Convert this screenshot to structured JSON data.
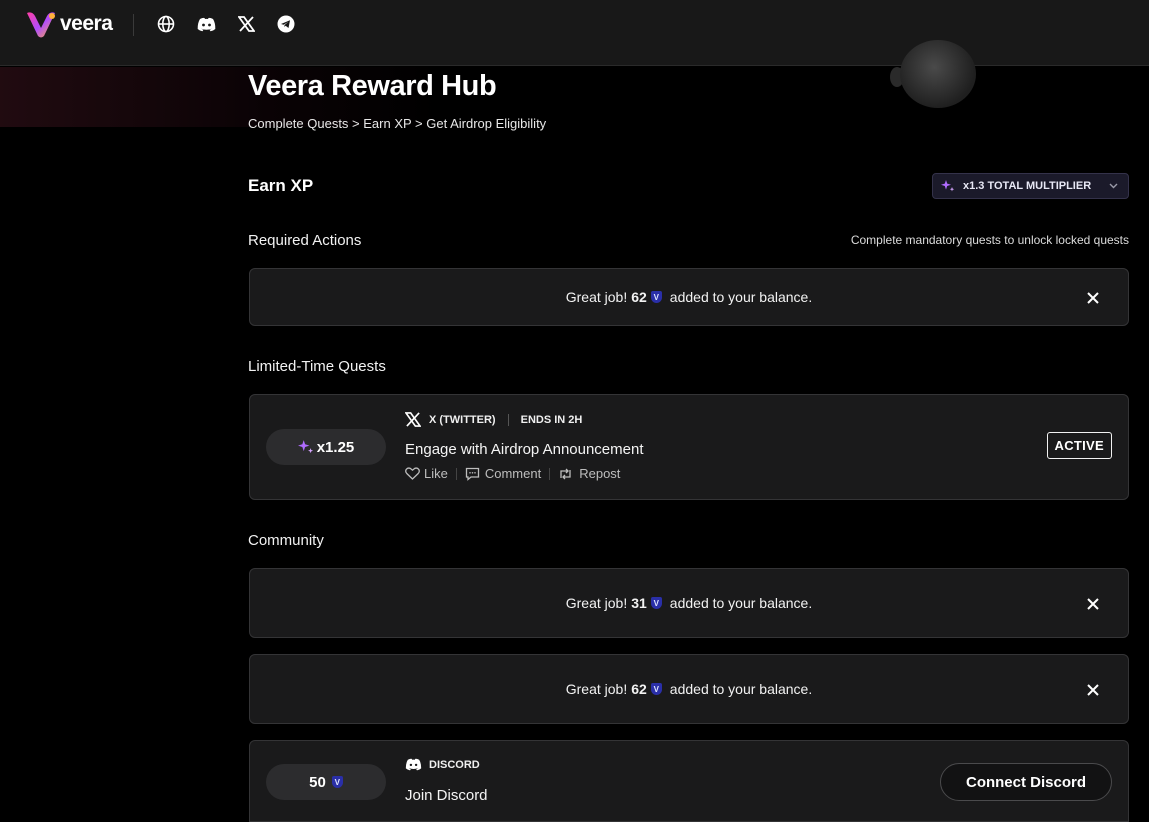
{
  "nav": {
    "logo_text": "veera",
    "socials": [
      "globe-icon",
      "discord-icon",
      "x-icon",
      "telegram-icon"
    ]
  },
  "hero": {
    "title": "Veera Reward Hub",
    "breadcrumb": "Complete Quests > Earn XP > Get Airdrop Eligibility"
  },
  "earn": {
    "heading": "Earn XP",
    "multiplier_label": "x1.3 TOTAL MULTIPLIER"
  },
  "required": {
    "heading": "Required Actions",
    "hint": "Complete mandatory quests to unlock locked quests",
    "toast": {
      "prefix": "Great job!",
      "amount": "62",
      "suffix": "added to your balance."
    }
  },
  "limited": {
    "heading": "Limited-Time Quests",
    "quest": {
      "multiplier": "x1.25",
      "platform": "X (TWITTER)",
      "ends": "ENDS IN 2H",
      "title": "Engage with Airdrop Announcement",
      "actions": [
        "Like",
        "Comment",
        "Repost"
      ],
      "status": "ACTIVE"
    }
  },
  "community": {
    "heading": "Community",
    "toasts": [
      {
        "prefix": "Great job!",
        "amount": "31",
        "suffix": "added to your balance."
      },
      {
        "prefix": "Great job!",
        "amount": "62",
        "suffix": "added to your balance."
      }
    ],
    "discord": {
      "reward": "50",
      "platform": "DISCORD",
      "title": "Join Discord",
      "button": "Connect Discord"
    }
  },
  "token_symbol": "V",
  "colors": {
    "accent_purple": "#b06cff",
    "token_blue": "#2a2fa8",
    "card_bg": "#1a1a1b"
  }
}
